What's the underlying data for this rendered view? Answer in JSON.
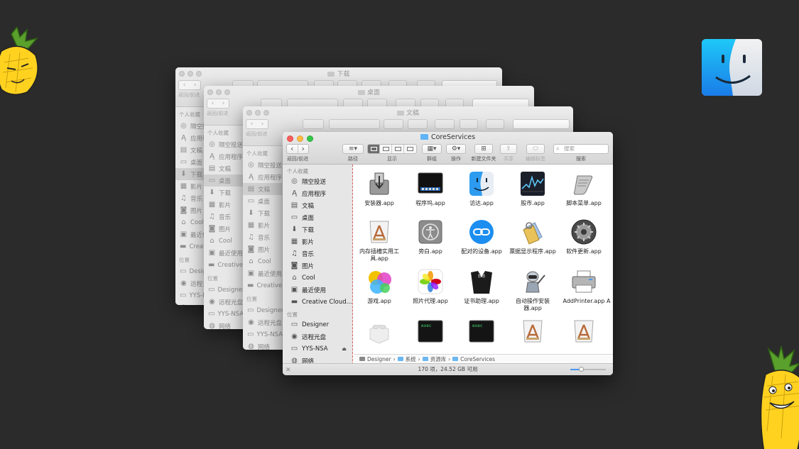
{
  "windows_bg": [
    {
      "title": "下载",
      "nav_label": "返回/前进"
    },
    {
      "title": "桌面",
      "nav_label": "返回/前进"
    },
    {
      "title": "文稿",
      "nav_label": "返回/前进"
    }
  ],
  "sidebar": {
    "section_favorites": "个人收藏",
    "section_locations": "位置",
    "favorites": [
      {
        "label": "隔空投送",
        "icon": "airdrop-icon",
        "glyph": "◎"
      },
      {
        "label": "应用程序",
        "icon": "applications-icon",
        "glyph": "Ą"
      },
      {
        "label": "文稿",
        "icon": "documents-icon",
        "glyph": "▤"
      },
      {
        "label": "桌面",
        "icon": "desktop-icon",
        "glyph": "▭"
      },
      {
        "label": "下载",
        "icon": "downloads-icon",
        "glyph": "⬇"
      },
      {
        "label": "影片",
        "icon": "movies-icon",
        "glyph": "▦"
      },
      {
        "label": "音乐",
        "icon": "music-icon",
        "glyph": "♫"
      },
      {
        "label": "图片",
        "icon": "pictures-icon",
        "glyph": "◙"
      },
      {
        "label": "Cool",
        "icon": "home-icon",
        "glyph": "⌂"
      },
      {
        "label": "最近使用",
        "icon": "recents-icon",
        "glyph": "▣"
      },
      {
        "label": "Creative Cloud...",
        "icon": "folder-icon",
        "glyph": "▬"
      }
    ],
    "locations": [
      {
        "label": "Designer",
        "icon": "hard-drive-icon",
        "glyph": "▭"
      },
      {
        "label": "远程光盘",
        "icon": "remote-disc-icon",
        "glyph": "◉"
      },
      {
        "label": "YYS-NSA",
        "icon": "network-drive-icon",
        "glyph": "▭",
        "eject": "⏏"
      },
      {
        "label": "网络",
        "icon": "network-icon",
        "glyph": "◍"
      }
    ],
    "bg_favorites": [
      {
        "label": "隔空投送",
        "glyph": "◎"
      },
      {
        "label": "应用程序",
        "glyph": "Ą"
      },
      {
        "label": "文稿",
        "glyph": "▤"
      },
      {
        "label": "桌面",
        "glyph": "▭"
      },
      {
        "label": "下载",
        "glyph": "⬇"
      },
      {
        "label": "影片",
        "glyph": "▦"
      },
      {
        "label": "音乐",
        "glyph": "♫"
      },
      {
        "label": "图片",
        "glyph": "◙"
      },
      {
        "label": "Cool",
        "glyph": "⌂"
      },
      {
        "label": "最近使用",
        "glyph": "▣"
      },
      {
        "label": "Creative Cloud...",
        "glyph": "▬"
      }
    ],
    "bg_locations": [
      {
        "label": "Designer",
        "glyph": "▭"
      },
      {
        "label": "远程光盘",
        "glyph": "◉"
      },
      {
        "label": "YYS-NSA",
        "glyph": "▭"
      },
      {
        "label": "网络",
        "glyph": "◍"
      }
    ]
  },
  "main_window": {
    "title": "CoreServices",
    "toolbar": {
      "nav_label": "返回/前进",
      "back": "‹",
      "forward": "›",
      "path_label": "路径",
      "view_label": "显示",
      "group_label": "群组",
      "action_label": "操作",
      "new_folder_label": "新建文件夹",
      "share_label": "共享",
      "edit_tags_label": "编辑标签",
      "search_placeholder": "搜索",
      "search_label": "搜索"
    },
    "items": [
      {
        "name": "安装器.app",
        "icon": "installer-icon"
      },
      {
        "name": "程序坞.app",
        "icon": "dock-icon"
      },
      {
        "name": "访达.app",
        "icon": "finder-icon"
      },
      {
        "name": "股市.app",
        "icon": "stocks-icon"
      },
      {
        "name": "脚本菜单.app",
        "icon": "script-menu-icon"
      },
      {
        "name": "内存插槽实用工具.app",
        "icon": "memory-slot-utility-icon"
      },
      {
        "name": "旁白.app",
        "icon": "voiceover-icon"
      },
      {
        "name": "配对的设备.app",
        "icon": "paired-devices-icon"
      },
      {
        "name": "票据显示程序.app",
        "icon": "ticket-viewer-icon"
      },
      {
        "name": "软件更新.app",
        "icon": "software-update-icon"
      },
      {
        "name": "游戏.app",
        "icon": "game-center-icon"
      },
      {
        "name": "照片代理.app",
        "icon": "photos-agent-icon"
      },
      {
        "name": "证书助理.app",
        "icon": "certificate-assistant-icon"
      },
      {
        "name": "自动操作安装器.app",
        "icon": "automator-installer-icon"
      },
      {
        "name": "AddPrinter.app",
        "icon": "add-printer-icon"
      },
      {
        "name": "",
        "icon": "lego-icon"
      },
      {
        "name": "",
        "icon": "exec-terminal-icon"
      },
      {
        "name": "",
        "icon": "exec-terminal-icon"
      },
      {
        "name": "",
        "icon": "app-document-icon"
      },
      {
        "name": "",
        "icon": "app-document-icon"
      }
    ],
    "partial_item": "A",
    "path": [
      {
        "label": "Designer",
        "icon": "hard-drive-icon"
      },
      {
        "label": "系统",
        "icon": "folder-icon"
      },
      {
        "label": "资源库",
        "icon": "folder-icon"
      },
      {
        "label": "CoreServices",
        "icon": "folder-icon"
      }
    ],
    "path_sep": "›",
    "status": "170 项，24.52 GB 可用",
    "zoom_level": 0.3
  },
  "colors": {
    "close": "#fc605c",
    "minimize": "#fdbc40",
    "zoom": "#34c84a",
    "finder_blue": "#2d9bf0"
  }
}
